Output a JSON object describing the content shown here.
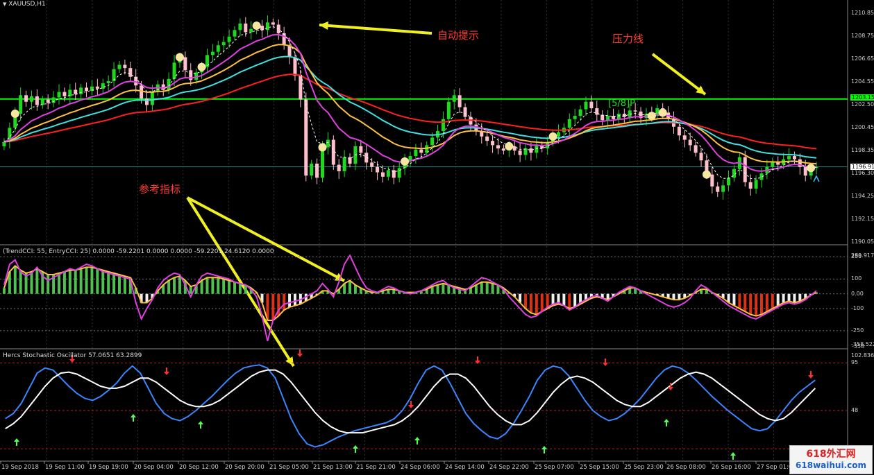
{
  "window": {
    "symbol_label": "XAUUSD,H1"
  },
  "indicators": {
    "cci_title": "(TrendCCI: 55, EntryCCI: 25)  0.0000 -59.2201 0.0000 0.0000 -59.2201 24.6120 0.0000",
    "stoch_title": "Hercs Stochastic Oscillator 57.0651 63.2899"
  },
  "annotations": {
    "auto_hint": "自动提示",
    "pressure_line": "压力线",
    "reference_indicator": "参考指标",
    "fib_label": "[5/8]P"
  },
  "price_axis": [
    "1210.85",
    "1208.75",
    "1206.65",
    "1204.55",
    "1202.50",
    "1200.45",
    "1198.35",
    "1196.30",
    "1194.25",
    "1192.15",
    "1190.05"
  ],
  "price_tags": {
    "resistance": "1203.15",
    "current": "1196.91"
  },
  "cci_axis": [
    "289.917",
    "250",
    "100",
    "0.00",
    "-100",
    "-250",
    "-358",
    "-358.522"
  ],
  "stoch_axis": [
    "102.836",
    "95",
    "48"
  ],
  "time_axis": [
    "19 Sep 2018",
    "19 Sep 11:00",
    "19 Sep 19:00",
    "20 Sep 04:00",
    "20 Sep 12:00",
    "20 Sep 20:00",
    "21 Sep 05:00",
    "21 Sep 13:00",
    "21 Sep 21:00",
    "24 Sep 06:00",
    "24 Sep 14:00",
    "24 Sep 22:00",
    "25 Sep 07:00",
    "25 Sep 15:00",
    "25 Sep 23:00",
    "26 Sep 08:00",
    "26 Sep 16:00",
    "27 Sep 01:00"
  ],
  "watermark": {
    "line1": "618外汇网",
    "line2": "618waihui.com"
  },
  "colors": {
    "background": "#000000",
    "bull": "#1fd81f",
    "bear": "#ffc0cb",
    "resistance": "#00ff00",
    "ma_red": "#ff2020",
    "ma_cyan": "#40e0e0",
    "ma_orange": "#ffc040",
    "ma_magenta": "#e040e0",
    "arrow_yellow": "#f0f020",
    "annotation_text": "#ff3b30",
    "stoch_blue": "#3a86ff",
    "stoch_white": "#ffffff"
  },
  "chart_data": {
    "price": {
      "type": "candlestick",
      "y_range": [
        1190.05,
        1211.5
      ],
      "resistance": 1203.15,
      "current": 1196.91,
      "closes": [
        1199.2,
        1200.5,
        1201.8,
        1203.5,
        1202.9,
        1203.4,
        1202.6,
        1203.1,
        1202.8,
        1203.3,
        1203.8,
        1203.4,
        1204.0,
        1203.6,
        1204.2,
        1203.9,
        1204.3,
        1204.1,
        1204.6,
        1204.8,
        1205.9,
        1206.3,
        1206.0,
        1205.2,
        1204.4,
        1203.2,
        1202.6,
        1203.8,
        1204.5,
        1204.0,
        1205.0,
        1206.5,
        1207.0,
        1205.8,
        1204.9,
        1205.6,
        1206.1,
        1207.2,
        1207.5,
        1208.1,
        1208.4,
        1208.9,
        1209.5,
        1210.1,
        1209.3,
        1209.6,
        1209.9,
        1209.5,
        1210.2,
        1210.0,
        1209.2,
        1208.1,
        1207.0,
        1205.3,
        1203.1,
        1196.1,
        1197.2,
        1195.9,
        1198.7,
        1199.4,
        1197.1,
        1196.5,
        1197.8,
        1197.2,
        1198.8,
        1198.2,
        1197.3,
        1196.9,
        1196.4,
        1196.0,
        1196.6,
        1195.9,
        1196.8,
        1197.4,
        1197.9,
        1198.5,
        1198.2,
        1198.9,
        1199.6,
        1200.2,
        1201.3,
        1202.9,
        1203.5,
        1202.4,
        1201.5,
        1200.8,
        1200.2,
        1199.7,
        1199.3,
        1198.9,
        1198.6,
        1198.4,
        1198.8,
        1198.4,
        1198.0,
        1198.6,
        1198.2,
        1198.9,
        1198.6,
        1199.2,
        1199.7,
        1200.1,
        1200.5,
        1201.3,
        1201.6,
        1202.2,
        1202.9,
        1202.3,
        1201.7,
        1201.2,
        1201.6,
        1201.3,
        1201.8,
        1201.5,
        1202.1,
        1202.0,
        1201.4,
        1201.8,
        1201.6,
        1202.3,
        1201.9,
        1201.3,
        1200.6,
        1199.8,
        1199.4,
        1198.9,
        1198.2,
        1197.5,
        1196.2,
        1195.1,
        1194.6,
        1195.2,
        1195.9,
        1196.7,
        1197.8,
        1195.5,
        1194.9,
        1195.7,
        1196.3,
        1196.9,
        1197.4,
        1197.1,
        1197.6,
        1197.9,
        1197.6,
        1196.9,
        1196.1,
        1196.8,
        1196.9
      ]
    },
    "cci": {
      "type": "line+histogram",
      "y_range": [
        -358.522,
        289.917
      ],
      "reference_lines": [
        250,
        100,
        0,
        -100,
        -250
      ],
      "magenta": [
        60,
        200,
        230,
        150,
        120,
        140,
        180,
        120,
        90,
        110,
        130,
        150,
        170,
        160,
        180,
        200,
        190,
        170,
        150,
        140,
        130,
        120,
        110,
        100,
        -60,
        -170,
        -100,
        -40,
        40,
        90,
        120,
        140,
        130,
        60,
        -20,
        60,
        120,
        140,
        130,
        120,
        110,
        100,
        80,
        70,
        60,
        30,
        -20,
        -150,
        -320,
        -180,
        -110,
        -70,
        -60,
        -50,
        -40,
        -20,
        0,
        20,
        70,
        30,
        -20,
        80,
        200,
        260,
        180,
        100,
        40,
        20,
        10,
        30,
        50,
        40,
        20,
        10,
        0,
        10,
        20,
        40,
        60,
        80,
        90,
        60,
        40,
        30,
        20,
        50,
        80,
        110,
        100,
        80,
        60,
        30,
        -20,
        -60,
        -100,
        -140,
        -160,
        -150,
        -120,
        -90,
        -70,
        -60,
        -80,
        -110,
        -90,
        -60,
        -40,
        -20,
        -10,
        -30,
        -50,
        -20,
        10,
        30,
        50,
        40,
        20,
        0,
        -20,
        -40,
        -60,
        -80,
        -90,
        -80,
        -60,
        -30,
        20,
        60,
        40,
        10,
        -20,
        -50,
        -80,
        -100,
        -120,
        -140,
        -160,
        -170,
        -150,
        -130,
        -110,
        -90,
        -70,
        -60,
        -70,
        -60,
        -40,
        -10,
        20
      ],
      "orange": [
        40,
        150,
        190,
        160,
        140,
        150,
        170,
        150,
        130,
        130,
        140,
        150,
        160,
        160,
        170,
        180,
        180,
        170,
        160,
        150,
        140,
        130,
        120,
        110,
        40,
        -60,
        -60,
        -30,
        20,
        60,
        90,
        110,
        120,
        90,
        50,
        60,
        90,
        110,
        110,
        110,
        100,
        90,
        80,
        70,
        60,
        40,
        10,
        -60,
        -180,
        -180,
        -150,
        -110,
        -90,
        -80,
        -70,
        -50,
        -30,
        -10,
        20,
        20,
        0,
        30,
        70,
        90,
        60,
        40,
        20,
        10,
        10,
        20,
        30,
        30,
        20,
        10,
        10,
        10,
        20,
        30,
        50,
        60,
        70,
        60,
        50,
        40,
        30,
        40,
        60,
        80,
        80,
        70,
        60,
        40,
        10,
        -20,
        -60,
        -100,
        -130,
        -140,
        -120,
        -100,
        -80,
        -70,
        -80,
        -100,
        -90,
        -70,
        -50,
        -30,
        -20,
        -30,
        -40,
        -20,
        0,
        20,
        40,
        40,
        20,
        10,
        0,
        -10,
        -20,
        -30,
        -40,
        -40,
        -30,
        -10,
        10,
        30,
        30,
        10,
        -10,
        -30,
        -60,
        -80,
        -100,
        -120,
        -140,
        -150,
        -140,
        -120,
        -100,
        -80,
        -60,
        -50,
        -60,
        -50,
        -30,
        -10,
        10
      ]
    },
    "stochastic": {
      "type": "line",
      "y_range": [
        0,
        102.836
      ],
      "levels": [
        95,
        48,
        10
      ],
      "blue": [
        40,
        45,
        55,
        70,
        85,
        90,
        88,
        80,
        72,
        65,
        60,
        58,
        62,
        68,
        75,
        85,
        92,
        85,
        70,
        55,
        45,
        40,
        38,
        42,
        48,
        55,
        62,
        70,
        78,
        85,
        90,
        92,
        93,
        90,
        80,
        60,
        40,
        25,
        15,
        12,
        14,
        18,
        22,
        25,
        28,
        30,
        32,
        34,
        36,
        40,
        48,
        60,
        75,
        88,
        92,
        88,
        75,
        60,
        45,
        35,
        28,
        22,
        20,
        25,
        35,
        48,
        62,
        78,
        88,
        92,
        90,
        82,
        70,
        58,
        48,
        42,
        38,
        40,
        45,
        52,
        60,
        70,
        80,
        88,
        92,
        90,
        85,
        78,
        70,
        62,
        55,
        48,
        42,
        36,
        30,
        28,
        30,
        38,
        48,
        58,
        66,
        72,
        78
      ],
      "white": [
        30,
        35,
        42,
        52,
        62,
        72,
        80,
        85,
        86,
        84,
        80,
        76,
        72,
        70,
        70,
        72,
        76,
        80,
        80,
        76,
        70,
        64,
        58,
        54,
        52,
        52,
        54,
        58,
        64,
        70,
        76,
        82,
        86,
        88,
        88,
        84,
        76,
        66,
        56,
        46,
        38,
        32,
        28,
        26,
        26,
        26,
        28,
        30,
        32,
        34,
        38,
        44,
        52,
        62,
        72,
        80,
        84,
        84,
        80,
        72,
        62,
        52,
        44,
        38,
        34,
        34,
        38,
        46,
        56,
        66,
        74,
        80,
        82,
        80,
        76,
        70,
        64,
        58,
        54,
        52,
        52,
        56,
        62,
        68,
        74,
        80,
        84,
        86,
        84,
        80,
        74,
        68,
        62,
        56,
        50,
        44,
        40,
        38,
        40,
        46,
        54,
        62,
        70
      ]
    }
  }
}
